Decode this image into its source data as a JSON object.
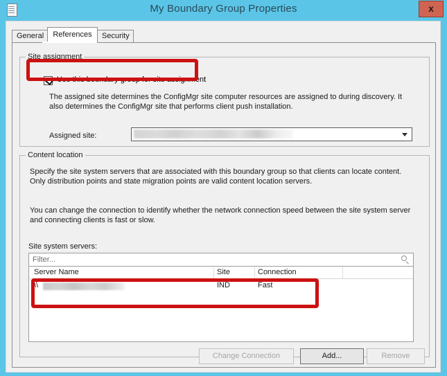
{
  "window": {
    "title": "My Boundary Group Properties",
    "icon": "properties-sheet-icon",
    "close_label": "x",
    "frame_color": "#5bc5e8",
    "body_color": "#f0f0f0"
  },
  "tabs": [
    {
      "id": "general",
      "label": "General",
      "active": false
    },
    {
      "id": "references",
      "label": "References",
      "active": true
    },
    {
      "id": "security",
      "label": "Security",
      "active": false
    }
  ],
  "site_assignment": {
    "caption": "Site assignment",
    "checkbox": {
      "label": "Use this boundary group for site assignment",
      "checked": true
    },
    "description": "The assigned site determines the ConfigMgr site computer resources are assigned to during discovery. It also determines the ConfigMgr site that performs client push installation.",
    "assigned_site": {
      "label": "Assigned site:",
      "value": "",
      "redacted": true
    }
  },
  "content_location": {
    "caption": "Content location",
    "paragraph_1": "Specify the site system servers that are associated with this boundary group so that clients can locate content. Only distribution points and state migration points are valid content location servers.",
    "paragraph_2": "You can change the connection to identify whether the network connection speed between the site system server and connecting clients is fast or slow.",
    "servers_label": "Site system servers:",
    "filter": {
      "placeholder": "Filter...",
      "value": "",
      "icon": "search-icon"
    },
    "table": {
      "columns": [
        "Server Name",
        "Site",
        "Connection"
      ],
      "rows": [
        {
          "server_name": "\\\\",
          "server_name_redacted": true,
          "site": "IND",
          "connection": "Fast"
        }
      ]
    },
    "buttons": [
      {
        "id": "change-connection",
        "label": "Change Connection",
        "enabled": false
      },
      {
        "id": "add",
        "label": "Add...",
        "enabled": true
      },
      {
        "id": "remove",
        "label": "Remove",
        "enabled": false
      }
    ]
  },
  "annotations": {
    "color": "#cc1111",
    "boxes": [
      "site-assignment-checkbox",
      "server-table-row"
    ]
  }
}
